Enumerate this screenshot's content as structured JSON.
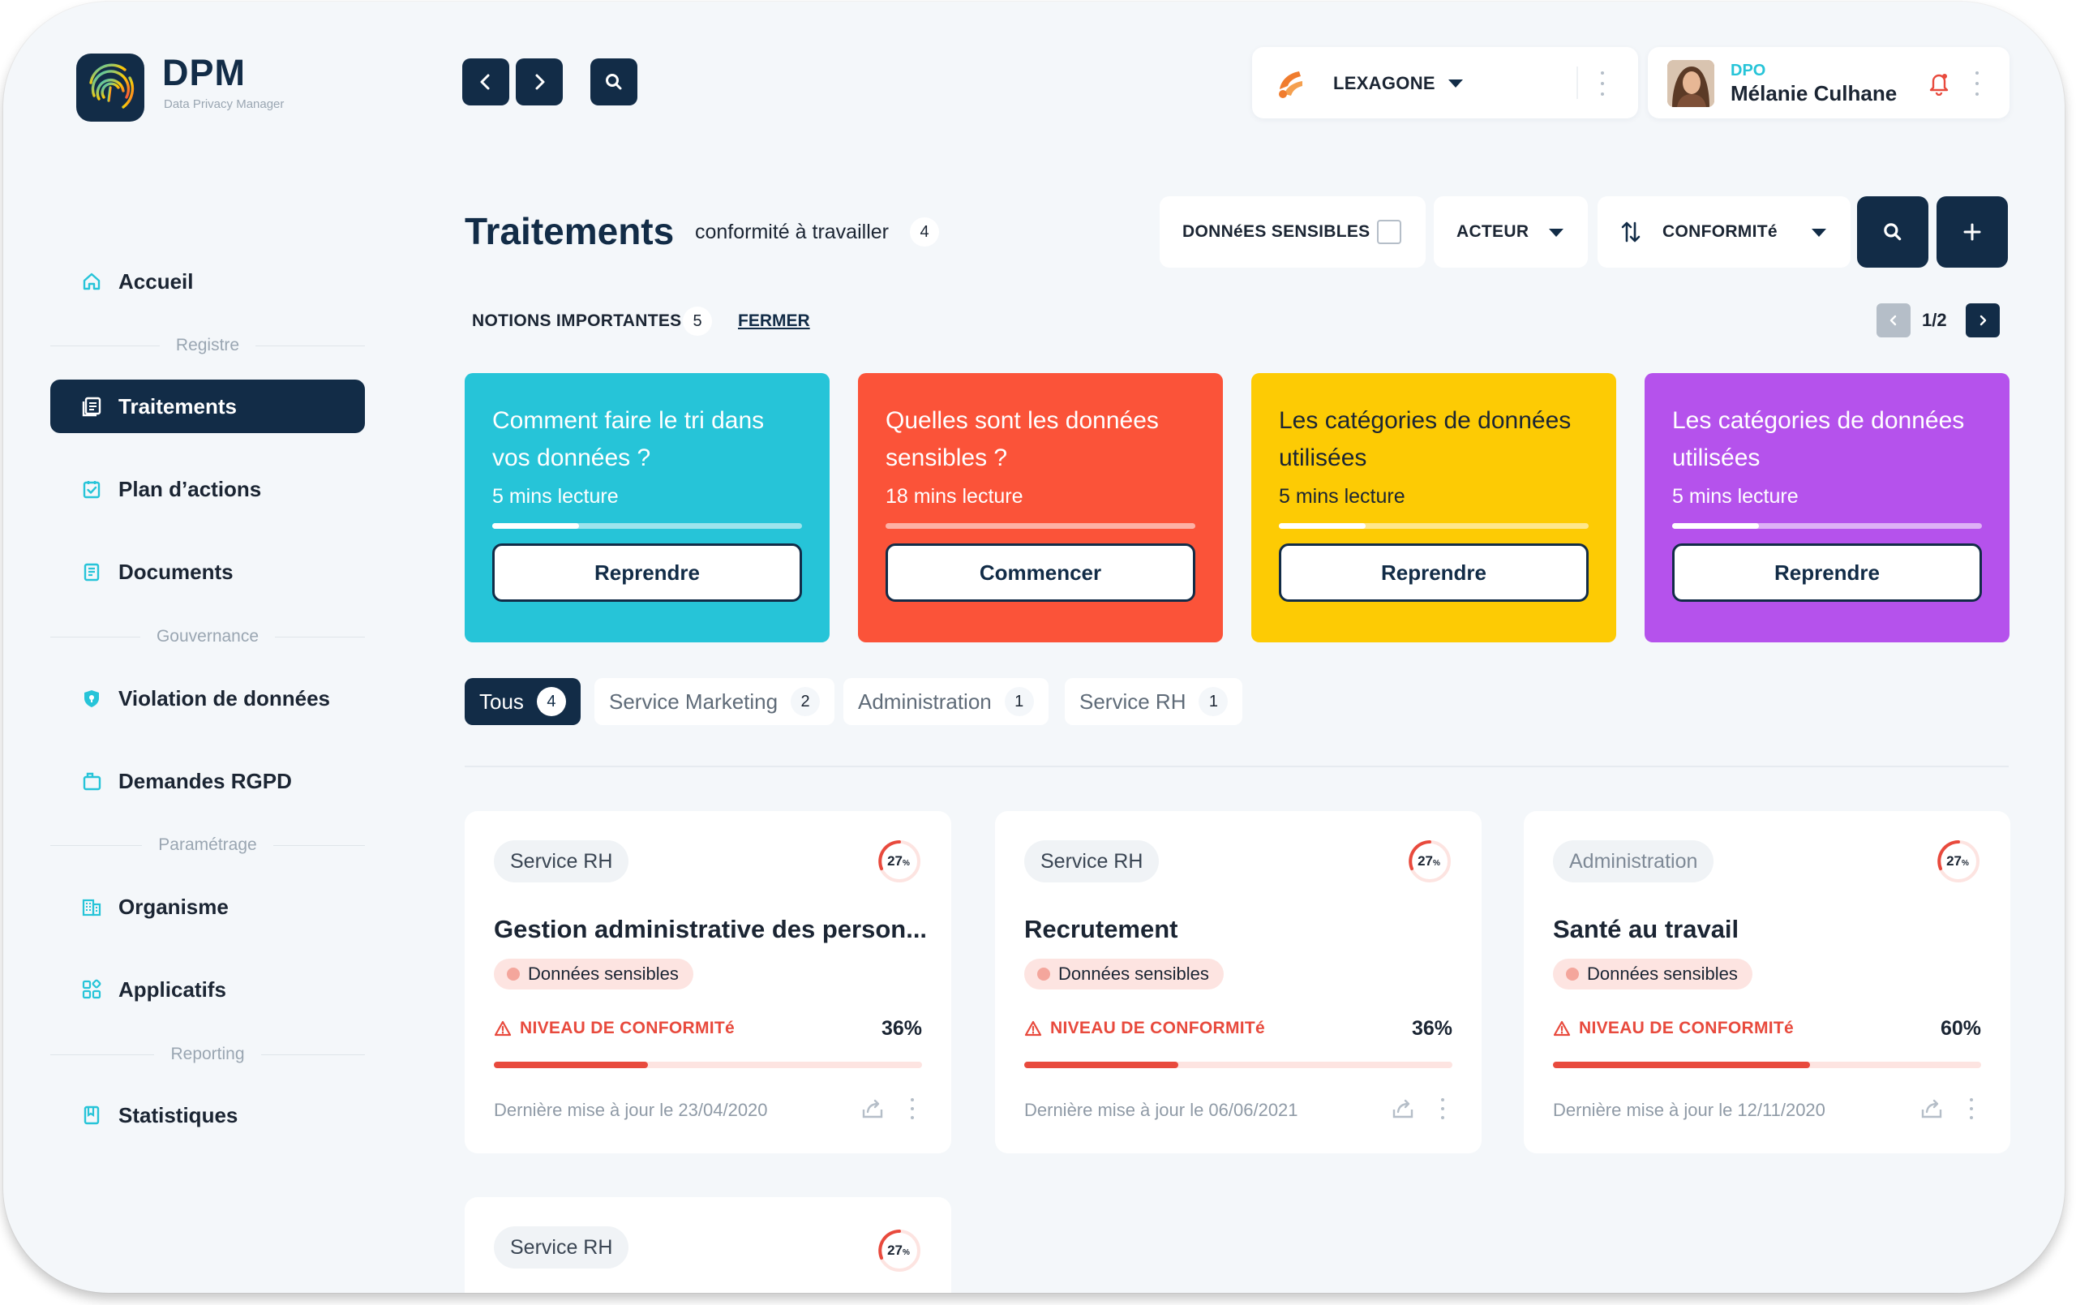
{
  "brand": {
    "name": "DPM",
    "tagline": "Data Privacy Manager"
  },
  "org": {
    "name": "LEXAGONE"
  },
  "user": {
    "role": "DPO",
    "name": "Mélanie Culhane"
  },
  "sidebar": {
    "items": [
      {
        "label": "Accueil",
        "icon": "home-icon"
      },
      {
        "label": "Traitements",
        "icon": "list-icon",
        "active": true
      },
      {
        "label": "Plan d’actions",
        "icon": "checklist-icon"
      },
      {
        "label": "Documents",
        "icon": "document-icon"
      },
      {
        "label": "Violation de données",
        "icon": "shield-icon"
      },
      {
        "label": "Demandes RGPD",
        "icon": "folder-icon"
      },
      {
        "label": "Organisme",
        "icon": "building-icon"
      },
      {
        "label": "Applicatifs",
        "icon": "apps-icon"
      },
      {
        "label": "Statistiques",
        "icon": "chart-icon"
      }
    ],
    "sections": [
      "Registre",
      "Gouvernance",
      "Paramétrage",
      "Reporting"
    ]
  },
  "header": {
    "title": "Traitements",
    "subtitle": "conformité à travailler",
    "subtitle_count": "4"
  },
  "filters": {
    "sensitive_label": "DONNéES SENSIBLES",
    "actor_label": "ACTEUR",
    "compliance_label": "CONFORMITé"
  },
  "notions": {
    "label": "NOTIONS IMPORTANTES",
    "count": "5",
    "close_label": "FERMER",
    "page": "1/2"
  },
  "articles": [
    {
      "title": "Comment faire le tri dans vos données ?",
      "read": "5 mins lecture",
      "progress": 0.28,
      "button": "Reprendre",
      "color": "#26c4d8"
    },
    {
      "title": "Quelles sont les données sensibles ?",
      "read": "18 mins lecture",
      "progress": 0.0,
      "button": "Commencer",
      "color": "#fb5339"
    },
    {
      "title": "Les catégories de données utilisées",
      "read": "5 mins lecture",
      "progress": 0.28,
      "button": "Reprendre",
      "color": "#fdcb04"
    },
    {
      "title": "Les catégories de données utilisées",
      "read": "5 mins lecture",
      "progress": 0.28,
      "button": "Reprendre",
      "color": "#b552ec"
    }
  ],
  "tabs": [
    {
      "label": "Tous",
      "count": "4",
      "active": true
    },
    {
      "label": "Service Marketing",
      "count": "2"
    },
    {
      "label": "Administration",
      "count": "1"
    },
    {
      "label": "Service RH",
      "count": "1"
    }
  ],
  "cards": [
    {
      "tag": "Service RH",
      "ring": "27",
      "ring_unit": "%",
      "title": "Gestion administrative des person...",
      "sensitive": "Données sensibles",
      "compliance_label": "NIVEAU DE CONFORMITé",
      "compliance": "36%",
      "compliance_value": 0.36,
      "updated": "Dernière mise à jour le 23/04/2020"
    },
    {
      "tag": "Service RH",
      "ring": "27",
      "ring_unit": "%",
      "title": "Recrutement",
      "sensitive": "Données sensibles",
      "compliance_label": "NIVEAU DE CONFORMITé",
      "compliance": "36%",
      "compliance_value": 0.36,
      "updated": "Dernière mise à jour le 06/06/2021"
    },
    {
      "tag": "Administration",
      "ring": "27",
      "ring_unit": "%",
      "title": "Santé au travail",
      "sensitive": "Données sensibles",
      "compliance_label": "NIVEAU DE CONFORMITé",
      "compliance": "60%",
      "compliance_value": 0.6,
      "updated": "Dernière mise à jour le 12/11/2020"
    },
    {
      "tag": "Service RH",
      "ring": "27",
      "ring_unit": "%"
    }
  ],
  "colors": {
    "primary": "#122c47",
    "accent": "#26c4d8",
    "danger": "#e84a3d",
    "orange": "#f07c2e"
  }
}
